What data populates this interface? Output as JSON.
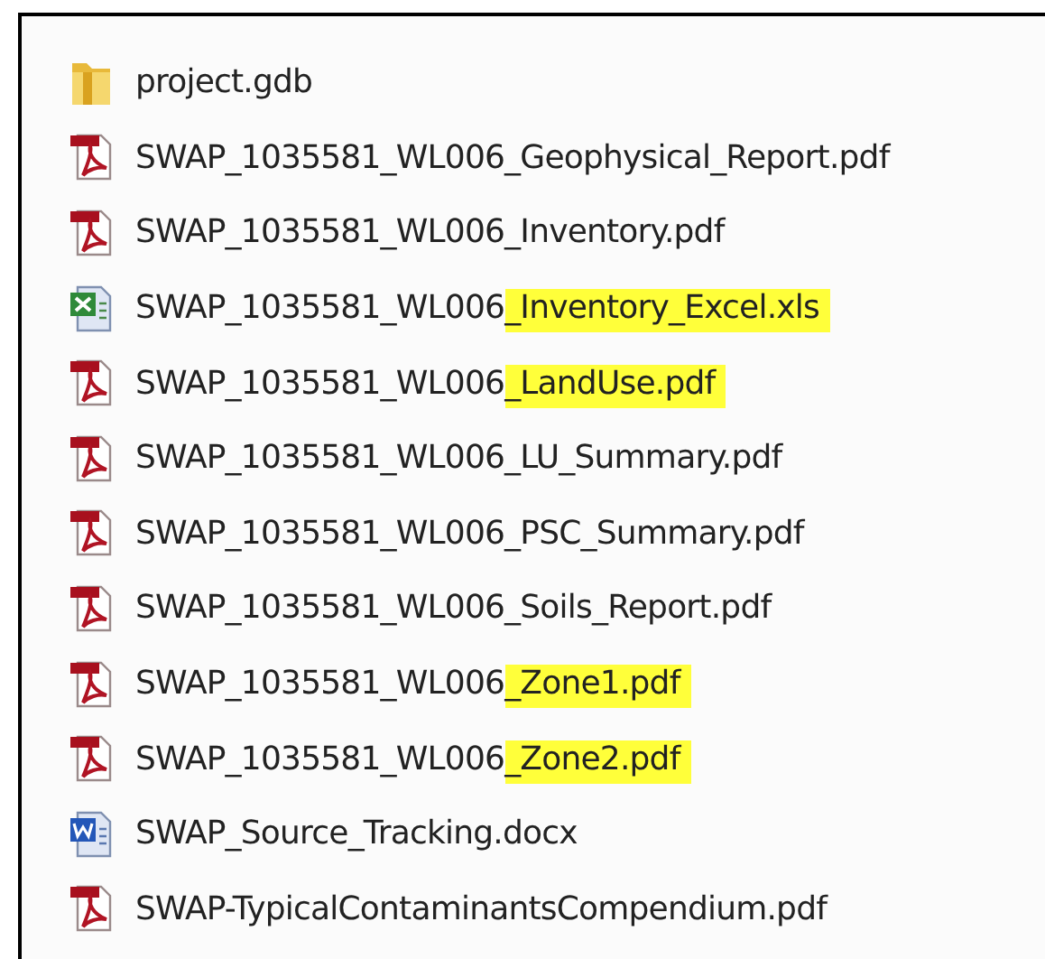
{
  "files": [
    {
      "kind": "folder",
      "name": "project.gdb"
    },
    {
      "kind": "pdf",
      "name": "SWAP_1035581_WL006_Geophysical_Report.pdf"
    },
    {
      "kind": "pdf",
      "name": "SWAP_1035581_WL006_Inventory.pdf"
    },
    {
      "kind": "excel",
      "name": "SWAP_1035581_WL006",
      "highlight": "_Inventory_Excel.xls"
    },
    {
      "kind": "pdf",
      "name": "SWAP_1035581_WL006",
      "highlight": "_LandUse.pdf"
    },
    {
      "kind": "pdf",
      "name": "SWAP_1035581_WL006_LU_Summary.pdf"
    },
    {
      "kind": "pdf",
      "name": "SWAP_1035581_WL006_PSC_Summary.pdf"
    },
    {
      "kind": "pdf",
      "name": "SWAP_1035581_WL006_Soils_Report.pdf"
    },
    {
      "kind": "pdf",
      "name": "SWAP_1035581_WL006",
      "highlight": "_Zone1.pdf"
    },
    {
      "kind": "pdf",
      "name": "SWAP_1035581_WL006",
      "highlight": "_Zone2.pdf"
    },
    {
      "kind": "word",
      "name": "SWAP_Source_Tracking.docx"
    },
    {
      "kind": "pdf",
      "name": "SWAP-TypicalContaminantsCompendium.pdf"
    }
  ]
}
